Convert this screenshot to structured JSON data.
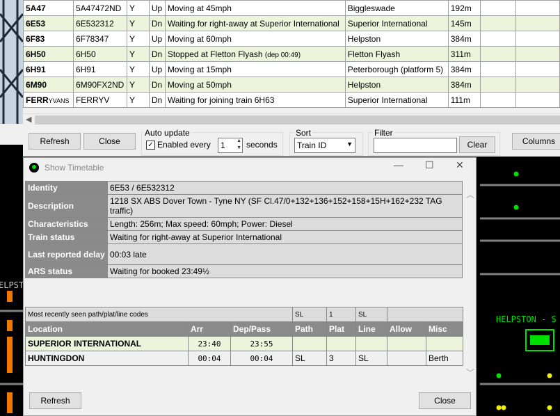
{
  "train_list": {
    "rows": [
      {
        "id": "5A47",
        "id_tag": "",
        "uid": "5A47472ND",
        "flag": "Y",
        "dir": "Up",
        "status": "Moving at 45mph",
        "status_note": "",
        "location": "Biggleswade",
        "length": "192m"
      },
      {
        "id": "6E53",
        "id_tag": "",
        "uid": "6E532312",
        "flag": "Y",
        "dir": "Dn",
        "status": "Waiting for right-away at Superior International",
        "status_note": "",
        "location": "Superior International",
        "length": "145m"
      },
      {
        "id": "6F83",
        "id_tag": "",
        "uid": "6F78347",
        "flag": "Y",
        "dir": "Up",
        "status": "Moving at 60mph",
        "status_note": "",
        "location": "Helpston",
        "length": "384m"
      },
      {
        "id": "6H50",
        "id_tag": "",
        "uid": "6H50",
        "flag": "Y",
        "dir": "Dn",
        "status": "Stopped at Fletton Flyash",
        "status_note": "(dep 00:49)",
        "location": "Fletton Flyash",
        "length": "311m"
      },
      {
        "id": "6H91",
        "id_tag": "",
        "uid": "6H91",
        "flag": "Y",
        "dir": "Up",
        "status": "Moving at 15mph",
        "status_note": "",
        "location": "Peterborough (platform 5)",
        "length": "384m"
      },
      {
        "id": "6M90",
        "id_tag": "",
        "uid": "6M90FX2ND",
        "flag": "Y",
        "dir": "Dn",
        "status": "Moving at 50mph",
        "status_note": "",
        "location": "Helpston",
        "length": "384m"
      },
      {
        "id": "FERR",
        "id_tag": "YVANS",
        "uid": "FERRYV",
        "flag": "Y",
        "dir": "Dn",
        "status": "Waiting for joining train 6H63",
        "status_note": "",
        "location": "Superior International",
        "length": "111m"
      }
    ],
    "refresh_label": "Refresh",
    "close_label": "Close",
    "auto_update": {
      "group_label": "Auto update",
      "enabled_label": "Enabled every",
      "enabled": true,
      "interval": "1",
      "unit_label": "seconds"
    },
    "sort": {
      "group_label": "Sort",
      "selected": "Train ID"
    },
    "filter": {
      "group_label": "Filter",
      "value": "",
      "clear_label": "Clear"
    },
    "columns_label": "Columns"
  },
  "timetable": {
    "window_title": "Show Timetable",
    "info": [
      {
        "label": "Identity",
        "value": "6E53 / 6E532312"
      },
      {
        "label": "Description",
        "value": "1218 SX ABS Dover Town - Tyne NY (SF Cl.47/0+132+136+152+158+15H+162+232 TAG traffic)"
      },
      {
        "label": "Characteristics",
        "value": "Length: 256m; Max speed: 60mph; Power: Diesel"
      },
      {
        "label": "Train status",
        "value": "Waiting for right-away at Superior International"
      },
      {
        "label": "Last reported delay",
        "value": "00:03 late"
      },
      {
        "label": "ARS status",
        "value": "Waiting for booked 23:49½"
      }
    ],
    "path_header": {
      "caption": "Most recently seen path/plat/line codes",
      "path": "SL",
      "plat": "1",
      "line": "SL"
    },
    "columns": [
      "Location",
      "Arr",
      "Dep/Pass",
      "Path",
      "Plat",
      "Line",
      "Allow",
      "Misc"
    ],
    "rows": [
      {
        "location": "SUPERIOR INTERNATIONAL",
        "arr": "23:40",
        "dep": "23:55",
        "path": "",
        "plat": "",
        "line": "",
        "allow": "",
        "misc": ""
      },
      {
        "location": "HUNTINGDON",
        "arr": "00:04",
        "dep": "00:04",
        "path": "SL",
        "plat": "3",
        "line": "SL",
        "allow": "",
        "misc": "Berth"
      }
    ],
    "refresh_label": "Refresh",
    "close_label": "Close"
  },
  "signal_panel": {
    "left_label": "ELPST",
    "right_label": "HELPSTON - S",
    "colors": {
      "track": "#808080",
      "signal_green": "#00e000",
      "signal_yellow": "#f0f000",
      "label_green": "#00e000",
      "orange": "#f07800"
    }
  }
}
